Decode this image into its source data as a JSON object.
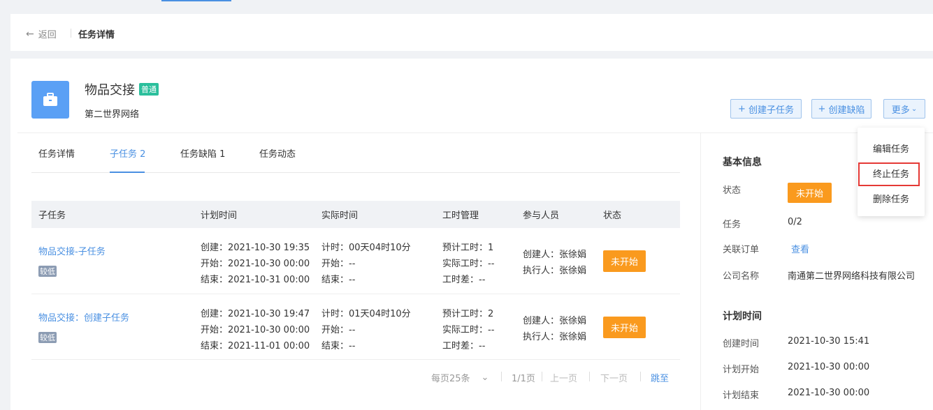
{
  "header": {
    "back_label": "返回",
    "page_title": "任务详情"
  },
  "task": {
    "name": "物品交接",
    "tag": "普通",
    "company": "第二世界网络"
  },
  "actions": {
    "create_subtask": "创建子任务",
    "create_defect": "创建缺陷",
    "more": "更多"
  },
  "tabs": [
    {
      "label": "任务详情"
    },
    {
      "label": "子任务 2"
    },
    {
      "label": "任务缺陷 1"
    },
    {
      "label": "任务动态"
    }
  ],
  "table": {
    "headers": [
      "子任务",
      "计划时间",
      "实际时间",
      "工时管理",
      "参与人员",
      "状态"
    ],
    "rows": [
      {
        "name": "物品交接-子任务",
        "priority": "较低",
        "plan": [
          "创建：2021-10-30 19:35",
          "开始：2021-10-30 00:00",
          "结束：2021-10-31 00:00"
        ],
        "actual": [
          "计时：00天04时10分",
          "开始：--",
          "结束：--"
        ],
        "hours": [
          "预计工时：1",
          "实际工时：--",
          "工时差：--"
        ],
        "people": [
          "创建人：张徐娟",
          "执行人：张徐娟"
        ],
        "status": "未开始"
      },
      {
        "name": "物品交接：创建子任务",
        "priority": "较低",
        "plan": [
          "创建：2021-10-30 19:47",
          "开始：2021-10-30 00:00",
          "结束：2021-11-01 00:00"
        ],
        "actual": [
          "计时：01天04时10分",
          "开始：--",
          "结束：--"
        ],
        "hours": [
          "预计工时：2",
          "实际工时：--",
          "工时差：--"
        ],
        "people": [
          "创建人：张徐娟",
          "执行人：张徐娟"
        ],
        "status": "未开始"
      }
    ]
  },
  "pager": {
    "page_size": "每页25条",
    "page_info": "1/1页",
    "prev": "上一页",
    "next": "下一页",
    "jump": "跳至"
  },
  "basic_info": {
    "heading": "基本信息",
    "status_label": "状态",
    "status_value": "未开始",
    "task_label": "任务",
    "task_value": "0/2",
    "order_label": "关联订单",
    "order_value": "查看",
    "company_label": "公司名称",
    "company_value": "南通第二世界网络科技有限公司"
  },
  "plan_time": {
    "heading": "计划时间",
    "created_label": "创建时间",
    "created_value": "2021-10-30 15:41",
    "start_label": "计划开始",
    "start_value": "2021-10-30 00:00",
    "end_label": "计划结束",
    "end_value": "2021-10-30 00:00"
  },
  "more_menu": {
    "items": [
      "编辑任务",
      "终止任务",
      "删除任务"
    ]
  },
  "colors": {
    "accent": "#4a90e2",
    "status_orange": "#fa9a1e",
    "tag_green": "#2bbf9c",
    "highlight_red": "#e53935"
  }
}
